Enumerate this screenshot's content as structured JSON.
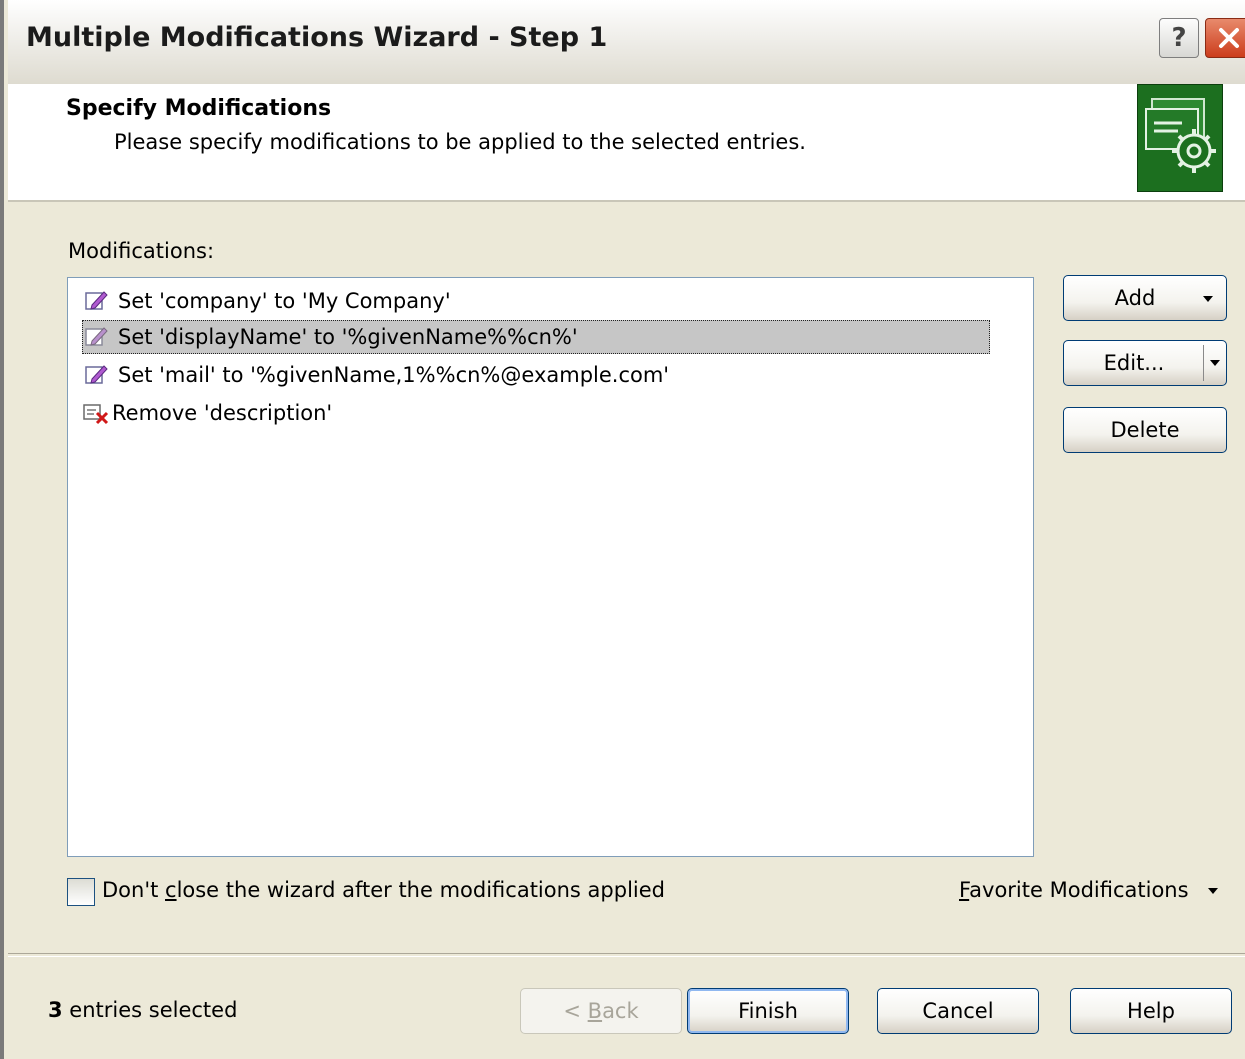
{
  "window": {
    "title": "Multiple Modifications Wizard - Step 1",
    "help_button": "?"
  },
  "header": {
    "title": "Specify Modifications",
    "subtitle": "Please specify modifications to be applied to the selected entries."
  },
  "modifications": {
    "label": "Modifications:",
    "items": [
      {
        "text": "Set 'company' to 'My Company'",
        "icon": "edit-pencil-icon",
        "selected": false
      },
      {
        "text": "Set 'displayName' to '%givenName%%cn%'",
        "icon": "edit-pencil-icon",
        "selected": true
      },
      {
        "text": "Set 'mail' to '%givenName,1%%cn%@example.com'",
        "icon": "edit-pencil-icon",
        "selected": false
      },
      {
        "text": "Remove 'description'",
        "icon": "remove-attribute-icon",
        "selected": false
      }
    ]
  },
  "side_buttons": {
    "add": "Add",
    "edit": "Edit...",
    "delete": "Delete"
  },
  "options": {
    "dont_close_prefix": "Don't ",
    "dont_close_mnemonic": "c",
    "dont_close_suffix": "lose the wizard after the modifications applied",
    "dont_close_checked": false,
    "favorites_mnemonic": "F",
    "favorites_rest": "avorite Modifications"
  },
  "footer": {
    "count": "3",
    "count_text": " entries selected",
    "back_prefix": "< ",
    "back_mnemonic": "B",
    "back_rest": "ack",
    "finish": "Finish",
    "cancel": "Cancel",
    "help": "Help"
  }
}
